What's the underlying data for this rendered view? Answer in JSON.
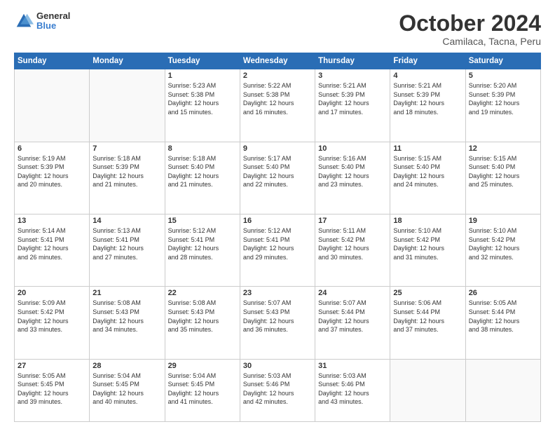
{
  "header": {
    "logo_line1": "General",
    "logo_line2": "Blue",
    "title": "October 2024",
    "location": "Camilaca, Tacna, Peru"
  },
  "calendar": {
    "days_of_week": [
      "Sunday",
      "Monday",
      "Tuesday",
      "Wednesday",
      "Thursday",
      "Friday",
      "Saturday"
    ],
    "weeks": [
      [
        {
          "day": "",
          "info": ""
        },
        {
          "day": "",
          "info": ""
        },
        {
          "day": "1",
          "info": "Sunrise: 5:23 AM\nSunset: 5:38 PM\nDaylight: 12 hours\nand 15 minutes."
        },
        {
          "day": "2",
          "info": "Sunrise: 5:22 AM\nSunset: 5:38 PM\nDaylight: 12 hours\nand 16 minutes."
        },
        {
          "day": "3",
          "info": "Sunrise: 5:21 AM\nSunset: 5:39 PM\nDaylight: 12 hours\nand 17 minutes."
        },
        {
          "day": "4",
          "info": "Sunrise: 5:21 AM\nSunset: 5:39 PM\nDaylight: 12 hours\nand 18 minutes."
        },
        {
          "day": "5",
          "info": "Sunrise: 5:20 AM\nSunset: 5:39 PM\nDaylight: 12 hours\nand 19 minutes."
        }
      ],
      [
        {
          "day": "6",
          "info": "Sunrise: 5:19 AM\nSunset: 5:39 PM\nDaylight: 12 hours\nand 20 minutes."
        },
        {
          "day": "7",
          "info": "Sunrise: 5:18 AM\nSunset: 5:39 PM\nDaylight: 12 hours\nand 21 minutes."
        },
        {
          "day": "8",
          "info": "Sunrise: 5:18 AM\nSunset: 5:40 PM\nDaylight: 12 hours\nand 21 minutes."
        },
        {
          "day": "9",
          "info": "Sunrise: 5:17 AM\nSunset: 5:40 PM\nDaylight: 12 hours\nand 22 minutes."
        },
        {
          "day": "10",
          "info": "Sunrise: 5:16 AM\nSunset: 5:40 PM\nDaylight: 12 hours\nand 23 minutes."
        },
        {
          "day": "11",
          "info": "Sunrise: 5:15 AM\nSunset: 5:40 PM\nDaylight: 12 hours\nand 24 minutes."
        },
        {
          "day": "12",
          "info": "Sunrise: 5:15 AM\nSunset: 5:40 PM\nDaylight: 12 hours\nand 25 minutes."
        }
      ],
      [
        {
          "day": "13",
          "info": "Sunrise: 5:14 AM\nSunset: 5:41 PM\nDaylight: 12 hours\nand 26 minutes."
        },
        {
          "day": "14",
          "info": "Sunrise: 5:13 AM\nSunset: 5:41 PM\nDaylight: 12 hours\nand 27 minutes."
        },
        {
          "day": "15",
          "info": "Sunrise: 5:12 AM\nSunset: 5:41 PM\nDaylight: 12 hours\nand 28 minutes."
        },
        {
          "day": "16",
          "info": "Sunrise: 5:12 AM\nSunset: 5:41 PM\nDaylight: 12 hours\nand 29 minutes."
        },
        {
          "day": "17",
          "info": "Sunrise: 5:11 AM\nSunset: 5:42 PM\nDaylight: 12 hours\nand 30 minutes."
        },
        {
          "day": "18",
          "info": "Sunrise: 5:10 AM\nSunset: 5:42 PM\nDaylight: 12 hours\nand 31 minutes."
        },
        {
          "day": "19",
          "info": "Sunrise: 5:10 AM\nSunset: 5:42 PM\nDaylight: 12 hours\nand 32 minutes."
        }
      ],
      [
        {
          "day": "20",
          "info": "Sunrise: 5:09 AM\nSunset: 5:42 PM\nDaylight: 12 hours\nand 33 minutes."
        },
        {
          "day": "21",
          "info": "Sunrise: 5:08 AM\nSunset: 5:43 PM\nDaylight: 12 hours\nand 34 minutes."
        },
        {
          "day": "22",
          "info": "Sunrise: 5:08 AM\nSunset: 5:43 PM\nDaylight: 12 hours\nand 35 minutes."
        },
        {
          "day": "23",
          "info": "Sunrise: 5:07 AM\nSunset: 5:43 PM\nDaylight: 12 hours\nand 36 minutes."
        },
        {
          "day": "24",
          "info": "Sunrise: 5:07 AM\nSunset: 5:44 PM\nDaylight: 12 hours\nand 37 minutes."
        },
        {
          "day": "25",
          "info": "Sunrise: 5:06 AM\nSunset: 5:44 PM\nDaylight: 12 hours\nand 37 minutes."
        },
        {
          "day": "26",
          "info": "Sunrise: 5:05 AM\nSunset: 5:44 PM\nDaylight: 12 hours\nand 38 minutes."
        }
      ],
      [
        {
          "day": "27",
          "info": "Sunrise: 5:05 AM\nSunset: 5:45 PM\nDaylight: 12 hours\nand 39 minutes."
        },
        {
          "day": "28",
          "info": "Sunrise: 5:04 AM\nSunset: 5:45 PM\nDaylight: 12 hours\nand 40 minutes."
        },
        {
          "day": "29",
          "info": "Sunrise: 5:04 AM\nSunset: 5:45 PM\nDaylight: 12 hours\nand 41 minutes."
        },
        {
          "day": "30",
          "info": "Sunrise: 5:03 AM\nSunset: 5:46 PM\nDaylight: 12 hours\nand 42 minutes."
        },
        {
          "day": "31",
          "info": "Sunrise: 5:03 AM\nSunset: 5:46 PM\nDaylight: 12 hours\nand 43 minutes."
        },
        {
          "day": "",
          "info": ""
        },
        {
          "day": "",
          "info": ""
        }
      ]
    ]
  }
}
